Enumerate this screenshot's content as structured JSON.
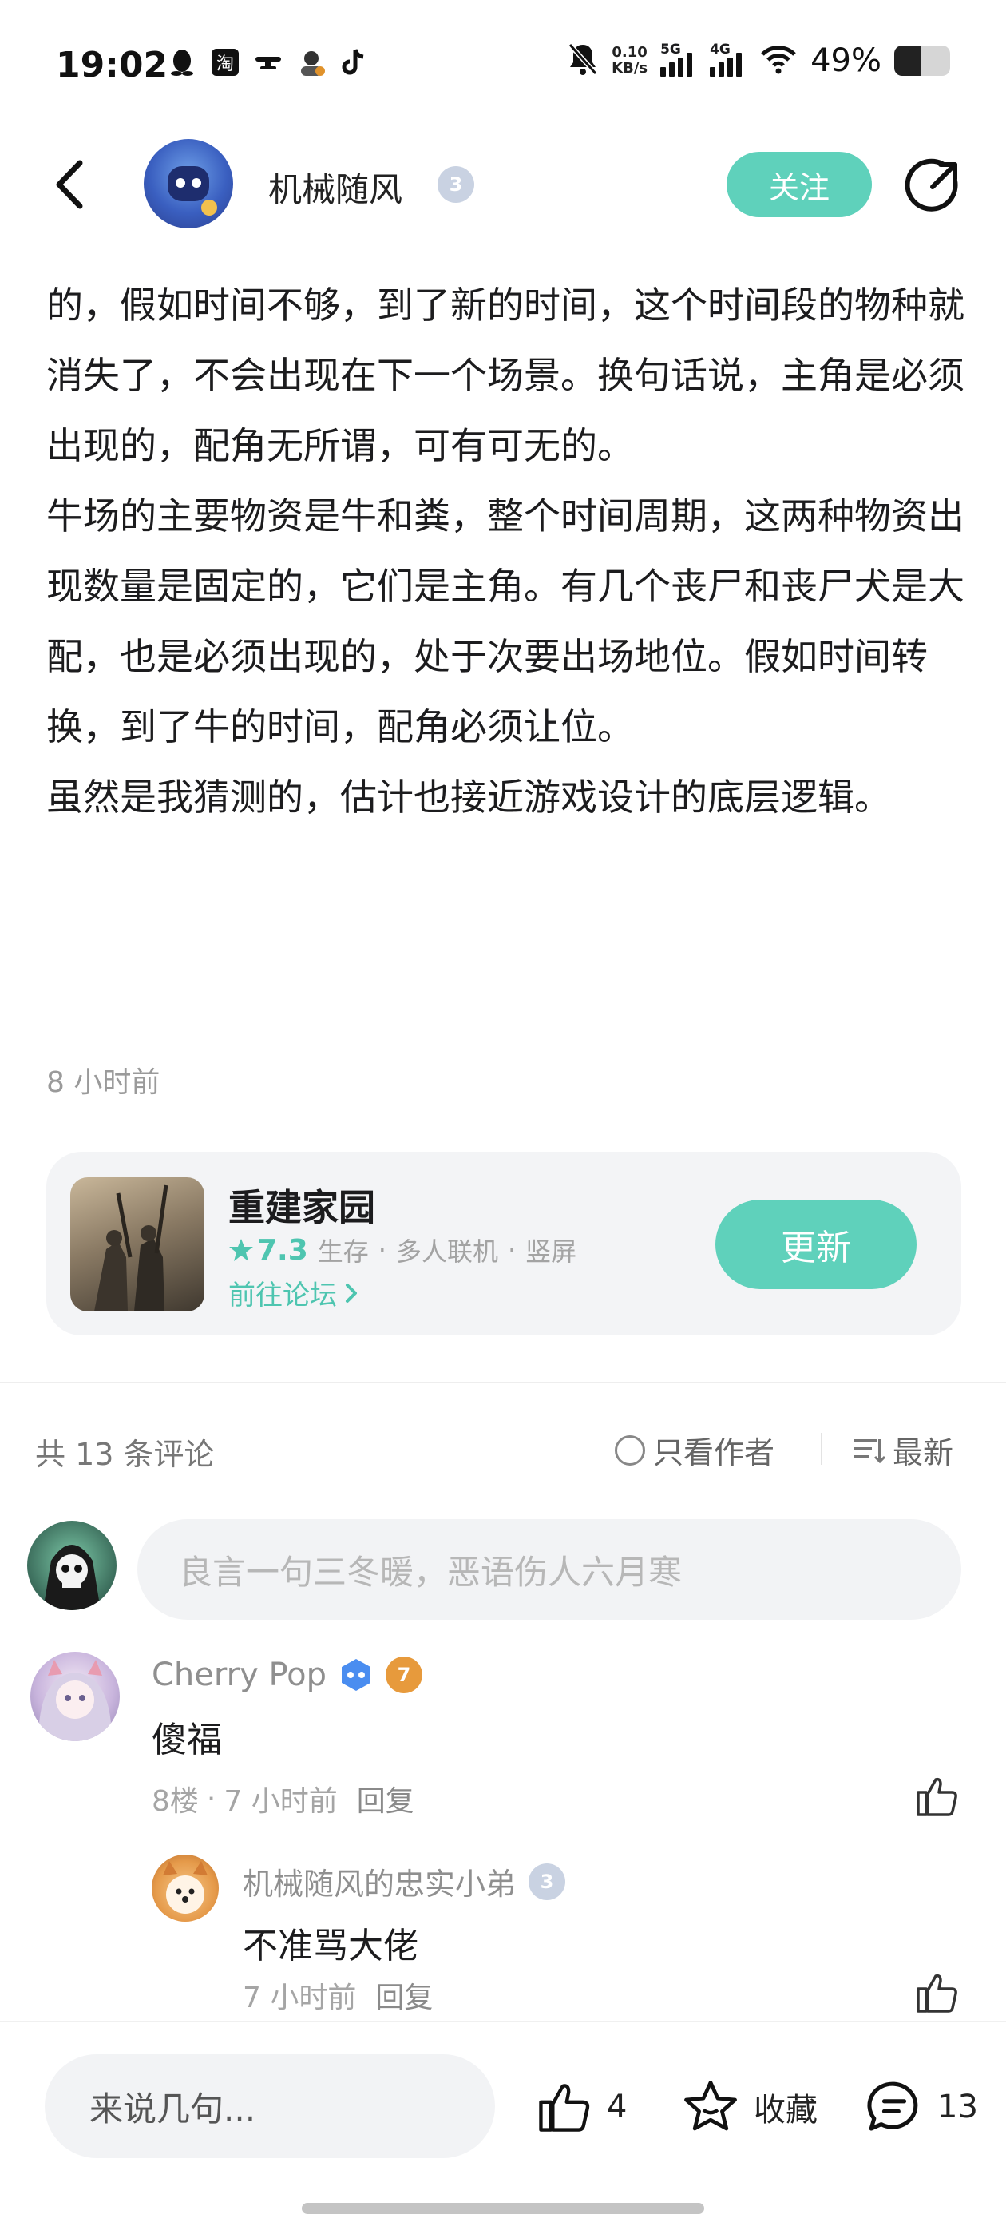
{
  "status_bar": {
    "time": "19:02",
    "network_speed_value": "0.10",
    "network_speed_unit": "KB/s",
    "signal1_label": "5G",
    "signal2_label": "4G",
    "battery_text": "49%",
    "battery_level": 0.49,
    "left_icons": [
      "qq-icon",
      "taobao-icon",
      "drone-icon",
      "avatar-icon",
      "tiktok-icon"
    ],
    "right_icons": [
      "mute-bell-icon",
      "signal-icon",
      "signal-icon",
      "wifi-icon",
      "battery-icon"
    ]
  },
  "header": {
    "author_name": "机械随风",
    "author_level": "3",
    "follow_label": "关注"
  },
  "article": {
    "paragraphs": [
      "的，假如时间不够，到了新的时间，这个时间段的物种就消失了，不会出现在下一个场景。换句话说，主角是必须出现的，配角无所谓，可有可无的。",
      "牛场的主要物资是牛和粪，整个时间周期，这两种物资出现数量是固定的，它们是主角。有几个丧尸和丧尸犬是大配，也是必须出现的，处于次要出场地位。假如时间转换，到了牛的时间，配角必须让位。",
      "虽然是我猜测的，估计也接近游戏设计的底层逻辑。"
    ],
    "time": "8 小时前"
  },
  "game_card": {
    "title": "重建家园",
    "rating": "7.3",
    "tags": [
      "生存",
      "多人联机",
      "竖屏"
    ],
    "separator": "·",
    "forum_link": "前往论坛",
    "update_label": "更新"
  },
  "comments": {
    "count_label": "共 13 条评论",
    "only_author_label": "只看作者",
    "sort_label": "最新",
    "input_placeholder": "良言一句三冬暖，恶语伤人六月寒",
    "items": [
      {
        "user": "Cherry Pop",
        "badge_level": "7",
        "text": "傻福",
        "floor": "8楼",
        "time": "7 小时前",
        "reply_label": "回复",
        "replies": [
          {
            "user": "机械随风的忠实小弟",
            "badge_level": "3",
            "text": "不准骂大佬",
            "time": "7 小时前",
            "reply_label": "回复"
          }
        ]
      }
    ]
  },
  "bottom_bar": {
    "input_placeholder": "来说几句...",
    "like_count": "4",
    "favorite_label": "收藏",
    "comment_count": "13"
  },
  "colors": {
    "accent": "#5fd1bb",
    "accent_text": "#4ec5b0",
    "muted": "#9a9a9a"
  }
}
